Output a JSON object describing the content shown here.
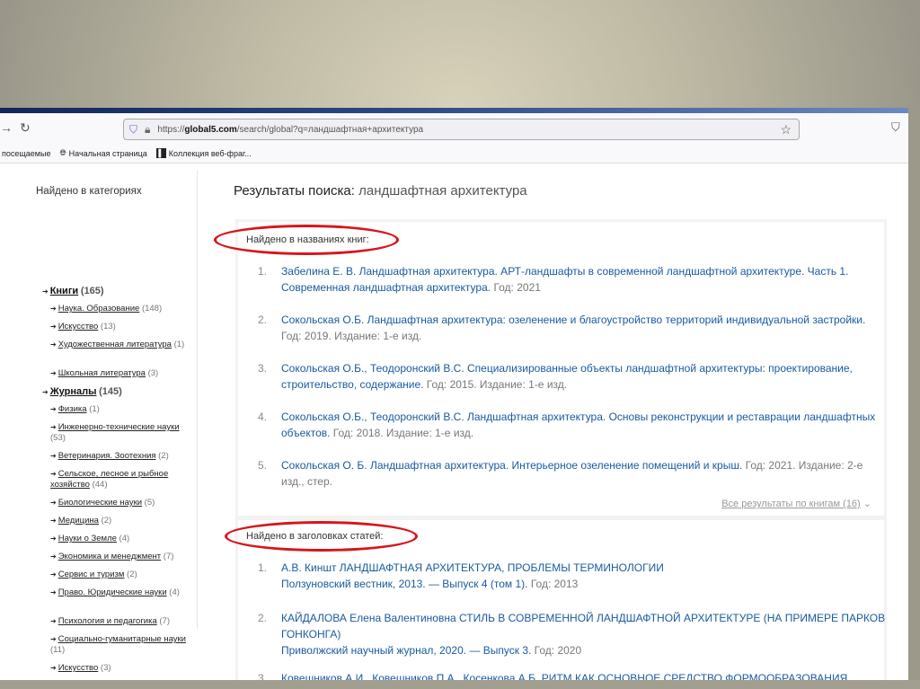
{
  "browser": {
    "url_prefix": "https://",
    "url_domain": "global5.com",
    "url_path": "/search/global?q=ландшафтная+архитектура",
    "bookmarks": [
      "посещаемые",
      "Начальная страница",
      "Коллекция веб-фраг..."
    ]
  },
  "sidebar": {
    "heading": "Найдено в категориях",
    "categories": [
      {
        "label": "Книги",
        "count": "(165)",
        "subs": [
          {
            "label": "Наука. Образование",
            "count": "(148)"
          },
          {
            "label": "Искусство",
            "count": "(13)"
          },
          {
            "label": "Художественная литература",
            "count": "(1)"
          },
          {
            "label": "Школьная литература",
            "count": "(3)"
          }
        ]
      },
      {
        "label": "Журналы",
        "count": "(145)",
        "subs": [
          {
            "label": "Физика",
            "count": "(1)"
          },
          {
            "label": "Инженерно-технические науки",
            "count": "(53)"
          },
          {
            "label": "Ветеринария. Зоотехния",
            "count": "(2)"
          },
          {
            "label": "Сельское, лесное и рыбное хозяйство",
            "count": "(44)"
          },
          {
            "label": "Биологические науки",
            "count": "(5)"
          },
          {
            "label": "Медицина",
            "count": "(2)"
          },
          {
            "label": "Науки о Земле",
            "count": "(4)"
          },
          {
            "label": "Экономика и менеджмент",
            "count": "(7)"
          },
          {
            "label": "Сервис и туризм",
            "count": "(2)"
          },
          {
            "label": "Право. Юридические науки",
            "count": "(4)"
          },
          {
            "label": "Психология и педагогика",
            "count": "(7)"
          },
          {
            "label": "Социально-гуманитарные науки",
            "count": "(11)"
          },
          {
            "label": "Искусство",
            "count": "(3)"
          }
        ]
      }
    ]
  },
  "main": {
    "title_label": "Результаты поиска:",
    "title_query": "ландшафтная архитектура",
    "books": {
      "heading": "Найдено в названиях книг:",
      "more": "Все результаты по книгам (16)",
      "items": [
        {
          "num": "1.",
          "link": "Забелина Е. В. Ландшафтная архитектура. АРТ-ландшафты в современной ландшафтной архитектуре. Часть 1. Современная ландшафтная архитектура.",
          "meta": " Год: 2021"
        },
        {
          "num": "2.",
          "link": "Сокольская О.Б. Ландшафтная архитектура: озеленение и благоустройство территорий индивидуальной застройки.",
          "meta": " Год: 2019. Издание: 1-е изд."
        },
        {
          "num": "3.",
          "link": "Сокольская О.Б., Теодоронский В.С. Специализированные объекты ландшафтной архитектуры: проектирование, строительство, содержание.",
          "meta": " Год: 2015. Издание: 1-е изд."
        },
        {
          "num": "4.",
          "link": "Сокольская О.Б., Теодоронский В.С. Ландшафтная архитектура. Основы реконструкции и реставрации ландшафтных объектов.",
          "meta": " Год: 2018. Издание: 1-е изд."
        },
        {
          "num": "5.",
          "link": "Сокольская О. Б. Ландшафтная архитектура. Интерьерное озеленение помещений и крыш.",
          "meta": " Год: 2021. Издание: 2-е изд., стер."
        }
      ]
    },
    "articles": {
      "heading": "Найдено в заголовках статей:",
      "items": [
        {
          "num": "1.",
          "link": "А.В. Киншт ЛАНДШАФТНАЯ АРХИТЕКТУРА, ПРОБЛЕМЫ ТЕРМИНОЛОГИИ",
          "source": "Ползуновский вестник, 2013. — Выпуск 4 (том 1).",
          "meta": " Год: 2013"
        },
        {
          "num": "2.",
          "link": "КАЙДАЛОВА Елена Валентиновна СТИЛЬ В СОВРЕМЕННОЙ ЛАНДШАФТНОЙ АРХИТЕКТУРЕ (НА ПРИМЕРЕ ПАРКОВ ГОНКОНГА)",
          "source": "Приволжский научный журнал, 2020. — Выпуск 3.",
          "meta": " Год: 2020"
        },
        {
          "num": "3.",
          "link": "Ковешников А.И., Ковешников П.А., Косенкова А.Б. РИТМ КАК ОСНОВНОЕ СРЕДСТВО ФОРМООБРАЗОВАНИЯ"
        }
      ]
    }
  },
  "colors": {
    "link": "#1a5aa0",
    "annotation": "#d8141c"
  }
}
